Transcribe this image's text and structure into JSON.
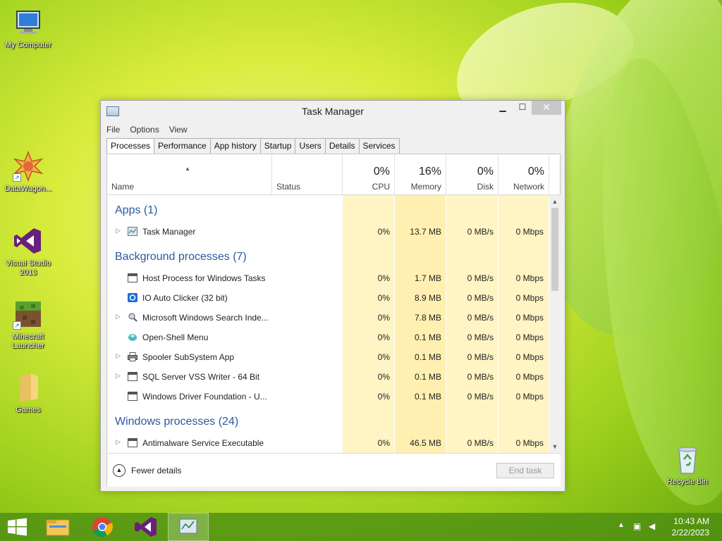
{
  "desktop": {
    "icons": [
      {
        "label": "My Computer"
      },
      {
        "label": "DataWagon..."
      },
      {
        "label": "Visual Studio 2013"
      },
      {
        "label": "Minecraft Launcher"
      },
      {
        "label": "Games"
      },
      {
        "label": "Recycle Bin"
      }
    ]
  },
  "window": {
    "title": "Task Manager",
    "menu": [
      "File",
      "Options",
      "View"
    ],
    "tabs": [
      "Processes",
      "Performance",
      "App history",
      "Startup",
      "Users",
      "Details",
      "Services"
    ],
    "active_tab": "Processes"
  },
  "columns": {
    "name": "Name",
    "status": "Status",
    "cpu": {
      "pct": "0%",
      "label": "CPU"
    },
    "memory": {
      "pct": "16%",
      "label": "Memory"
    },
    "disk": {
      "pct": "0%",
      "label": "Disk"
    },
    "network": {
      "pct": "0%",
      "label": "Network"
    }
  },
  "groups": {
    "apps": "Apps (1)",
    "background": "Background processes (7)",
    "windows": "Windows processes (24)"
  },
  "rows": [
    {
      "name": "Task Manager",
      "cpu": "0%",
      "mem": "13.7 MB",
      "disk": "0 MB/s",
      "net": "0 Mbps",
      "expandable": true,
      "icon": "task-manager-icon"
    },
    {
      "name": "Host Process for Windows Tasks",
      "cpu": "0%",
      "mem": "1.7 MB",
      "disk": "0 MB/s",
      "net": "0 Mbps",
      "expandable": false,
      "icon": "window-process-icon"
    },
    {
      "name": "IO Auto Clicker (32 bit)",
      "cpu": "0%",
      "mem": "8.9 MB",
      "disk": "0 MB/s",
      "net": "0 Mbps",
      "expandable": false,
      "icon": "auto-clicker-icon"
    },
    {
      "name": "Microsoft Windows Search Inde...",
      "cpu": "0%",
      "mem": "7.8 MB",
      "disk": "0 MB/s",
      "net": "0 Mbps",
      "expandable": true,
      "icon": "search-indexer-icon"
    },
    {
      "name": "Open-Shell Menu",
      "cpu": "0%",
      "mem": "0.1 MB",
      "disk": "0 MB/s",
      "net": "0 Mbps",
      "expandable": false,
      "icon": "shell-icon"
    },
    {
      "name": "Spooler SubSystem App",
      "cpu": "0%",
      "mem": "0.1 MB",
      "disk": "0 MB/s",
      "net": "0 Mbps",
      "expandable": true,
      "icon": "printer-icon"
    },
    {
      "name": "SQL Server VSS Writer - 64 Bit",
      "cpu": "0%",
      "mem": "0.1 MB",
      "disk": "0 MB/s",
      "net": "0 Mbps",
      "expandable": true,
      "icon": "window-process-icon"
    },
    {
      "name": "Windows Driver Foundation - U...",
      "cpu": "0%",
      "mem": "0.1 MB",
      "disk": "0 MB/s",
      "net": "0 Mbps",
      "expandable": false,
      "icon": "window-process-icon"
    },
    {
      "name": "Antimalware Service Executable",
      "cpu": "0%",
      "mem": "46.5 MB",
      "disk": "0 MB/s",
      "net": "0 Mbps",
      "expandable": true,
      "icon": "window-process-icon"
    }
  ],
  "footer": {
    "fewer_details": "Fewer details",
    "end_task": "End task"
  },
  "taskbar": {
    "time": "10:43 AM",
    "date": "2/22/2023"
  }
}
